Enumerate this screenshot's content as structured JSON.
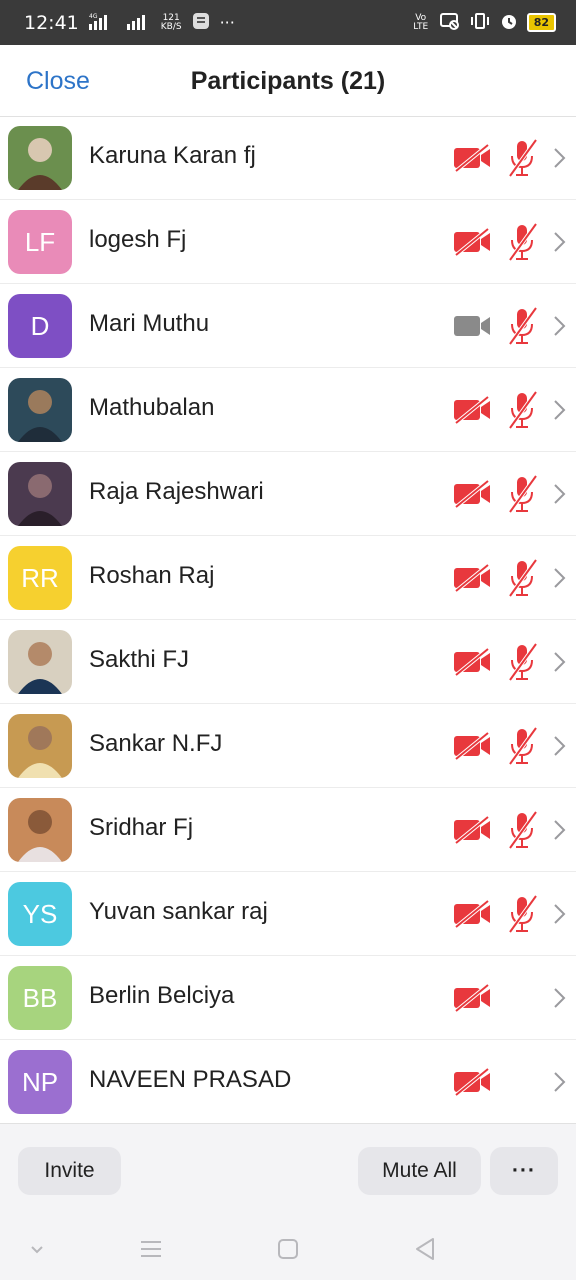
{
  "status_bar": {
    "time": "12:41",
    "network_top": "4G",
    "speed_value": "121",
    "speed_unit": "KB/S",
    "more": "···",
    "volte": "Vo LTE",
    "battery": "82"
  },
  "header": {
    "close_label": "Close",
    "title": "Participants (21)"
  },
  "participants": [
    {
      "name": "Karuna Karan fj",
      "avatar_type": "photo",
      "camera": "off",
      "mic": "muted"
    },
    {
      "name": "logesh Fj",
      "avatar_type": "initials",
      "initials": "LF",
      "avatar_color": "#e98bb8",
      "camera": "off",
      "mic": "muted"
    },
    {
      "name": "Mari Muthu",
      "avatar_type": "initials",
      "initials": "D",
      "avatar_color": "#7e4fc4",
      "camera": "on",
      "mic": "muted"
    },
    {
      "name": "Mathubalan",
      "avatar_type": "photo",
      "camera": "off",
      "mic": "muted"
    },
    {
      "name": "Raja Rajeshwari",
      "avatar_type": "photo",
      "camera": "off",
      "mic": "muted"
    },
    {
      "name": "Roshan Raj",
      "avatar_type": "initials",
      "initials": "RR",
      "avatar_color": "#f6d02f",
      "camera": "off",
      "mic": "muted"
    },
    {
      "name": "Sakthi FJ",
      "avatar_type": "photo",
      "camera": "off",
      "mic": "muted"
    },
    {
      "name": "Sankar N.FJ",
      "avatar_type": "photo",
      "camera": "off",
      "mic": "muted"
    },
    {
      "name": "Sridhar Fj",
      "avatar_type": "photo",
      "camera": "off",
      "mic": "muted"
    },
    {
      "name": "Yuvan sankar raj",
      "avatar_type": "initials",
      "initials": "YS",
      "avatar_color": "#4cc9e0",
      "camera": "off",
      "mic": "muted"
    },
    {
      "name": "Berlin Belciya",
      "avatar_type": "initials",
      "initials": "BB",
      "avatar_color": "#a7d47e",
      "camera": "off",
      "mic": "none"
    },
    {
      "name": "NAVEEN PRASAD",
      "avatar_type": "initials",
      "initials": "NP",
      "avatar_color": "#9b6fd0",
      "camera": "off",
      "mic": "none"
    }
  ],
  "toolbar": {
    "invite_label": "Invite",
    "mute_all_label": "Mute All",
    "more_label": "···"
  },
  "colors": {
    "accent": "#2d74c8",
    "muted_red": "#e8383d",
    "camera_on_gray": "#8a8a8a"
  },
  "icons": {
    "camera_off": "video-camera-slash-icon",
    "camera_on": "video-camera-icon",
    "mic_muted": "microphone-slash-icon",
    "row_action": "chevron-right-icon"
  }
}
